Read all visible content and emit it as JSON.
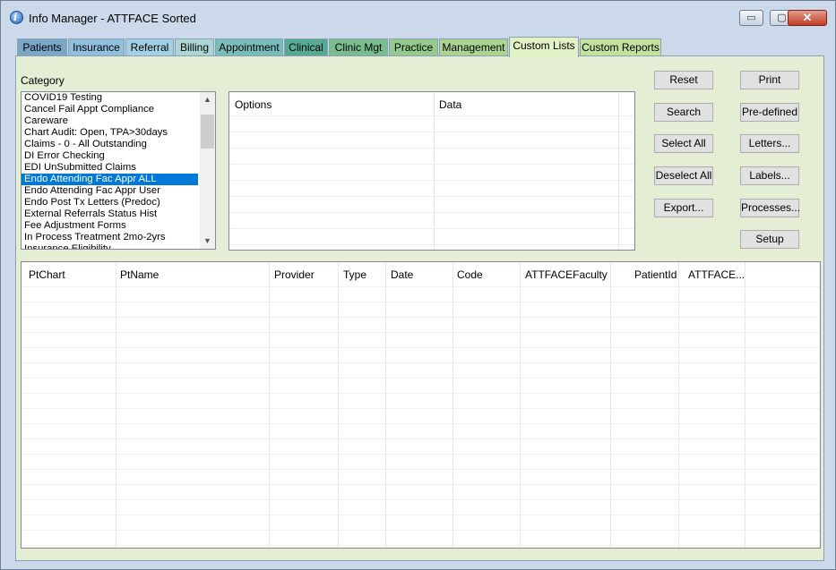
{
  "window": {
    "title": "Info Manager - ATTFACE Sorted",
    "controls": {
      "minimize": "▭",
      "maximize": "▢",
      "close": "✕"
    }
  },
  "tabs": [
    {
      "label": "Patients",
      "color": "#7aa6c7"
    },
    {
      "label": "Insurance",
      "color": "#8fbfdc"
    },
    {
      "label": "Referral",
      "color": "#a4d0e6"
    },
    {
      "label": "Billing",
      "color": "#acd6d6"
    },
    {
      "label": "Appointment",
      "color": "#79bdbb"
    },
    {
      "label": "Clinical",
      "color": "#55aa94"
    },
    {
      "label": "Clinic Mgt",
      "color": "#79bd8f"
    },
    {
      "label": "Practice",
      "color": "#95c98d"
    },
    {
      "label": "Management",
      "color": "#abd493"
    },
    {
      "label": "Custom Lists",
      "color": "#e2f1c6",
      "active": true
    },
    {
      "label": "Custom Reports",
      "color": "#c3e29d"
    }
  ],
  "category": {
    "label": "Category",
    "items": [
      "COVID19 Testing",
      "Cancel Fail Appt Compliance",
      "Careware",
      "Chart Audit: Open, TPA>30days",
      "Claims - 0 - All Outstanding",
      "DI Error Checking",
      "EDI UnSubmitted Claims",
      "Endo Attending Fac Appr ALL",
      "Endo Attending Fac Appr User",
      "Endo Post Tx Letters (Predoc)",
      "External Referrals Status Hist",
      "Fee Adjustment Forms",
      "In Process Treatment 2mo-2yrs",
      "Insurance Eligibility"
    ],
    "selected_index": 7
  },
  "options_grid": {
    "headers": [
      "Options",
      "Data"
    ]
  },
  "buttons": {
    "reset": "Reset",
    "print": "Print",
    "search": "Search",
    "predefined": "Pre-defined",
    "select_all": "Select All",
    "letters": "Letters...",
    "deselect_all": "Deselect All",
    "labels": "Labels...",
    "export": "Export...",
    "processes": "Processes...",
    "setup": "Setup"
  },
  "results_grid": {
    "headers": [
      "PtChart",
      "PtName",
      "Provider",
      "Type",
      "Date",
      "Code",
      "ATTFACEFaculty",
      "PatientId",
      "ATTFACE..."
    ]
  }
}
